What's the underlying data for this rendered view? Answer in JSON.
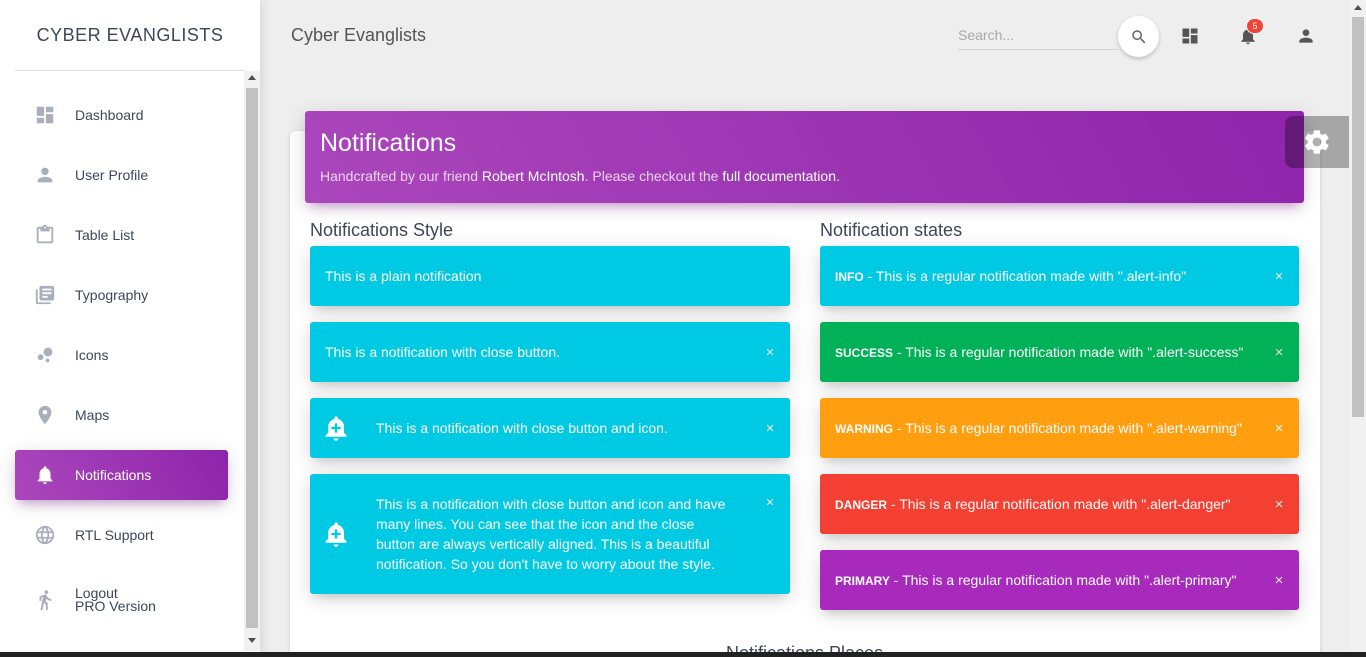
{
  "brand": "CYBER EVANGLISTS",
  "sidebar": {
    "items": [
      {
        "label": "Dashboard",
        "icon": "dashboard-icon"
      },
      {
        "label": "User Profile",
        "icon": "person-icon"
      },
      {
        "label": "Table List",
        "icon": "clipboard-icon"
      },
      {
        "label": "Typography",
        "icon": "library-books-icon"
      },
      {
        "label": "Icons",
        "icon": "bubble-chart-icon"
      },
      {
        "label": "Maps",
        "icon": "location-icon"
      },
      {
        "label": "Notifications",
        "icon": "notifications-icon",
        "active": true
      },
      {
        "label": "RTL Support",
        "icon": "language-icon"
      },
      {
        "label": "Logout",
        "label2": "PRO Version",
        "icon": "logout-icon"
      }
    ]
  },
  "topnav": {
    "title": "Cyber Evanglists",
    "search_placeholder": "Search...",
    "notification_count": "5"
  },
  "card": {
    "title": "Notifications",
    "subtitle_prefix": "Handcrafted by our friend ",
    "subtitle_name": "Robert McIntosh",
    "subtitle_mid": ". Please checkout the ",
    "subtitle_link": "full documentation",
    "subtitle_end": "."
  },
  "styles": {
    "title": "Notifications Style",
    "plain": "This is a plain notification",
    "close": "This is a notification with close button.",
    "icon": "This is a notification with close button and icon.",
    "multiline": "This is a notification with close button and icon and have many lines. You can see that the icon and the close button are always vertically aligned. This is a beautiful notification. So you don't have to worry about the style."
  },
  "states": {
    "title": "Notification states",
    "items": [
      {
        "label": "INFO",
        "text": " - This is a regular notification made with \".alert-info\""
      },
      {
        "label": "SUCCESS",
        "text": " - This is a regular notification made with \".alert-success\""
      },
      {
        "label": "WARNING",
        "text": " - This is a regular notification made with \".alert-warning\""
      },
      {
        "label": "DANGER",
        "text": " - This is a regular notification made with \".alert-danger\""
      },
      {
        "label": "PRIMARY",
        "text": " - This is a regular notification made with \".alert-primary\""
      }
    ]
  },
  "close_symbol": "×",
  "places_title": "Notifications Places",
  "colors": {
    "info": "#00cae3",
    "success": "#00b157",
    "warning": "#ff9e0f",
    "danger": "#f44033",
    "primary": "#a72abd",
    "active_nav": "#9c27b0"
  }
}
